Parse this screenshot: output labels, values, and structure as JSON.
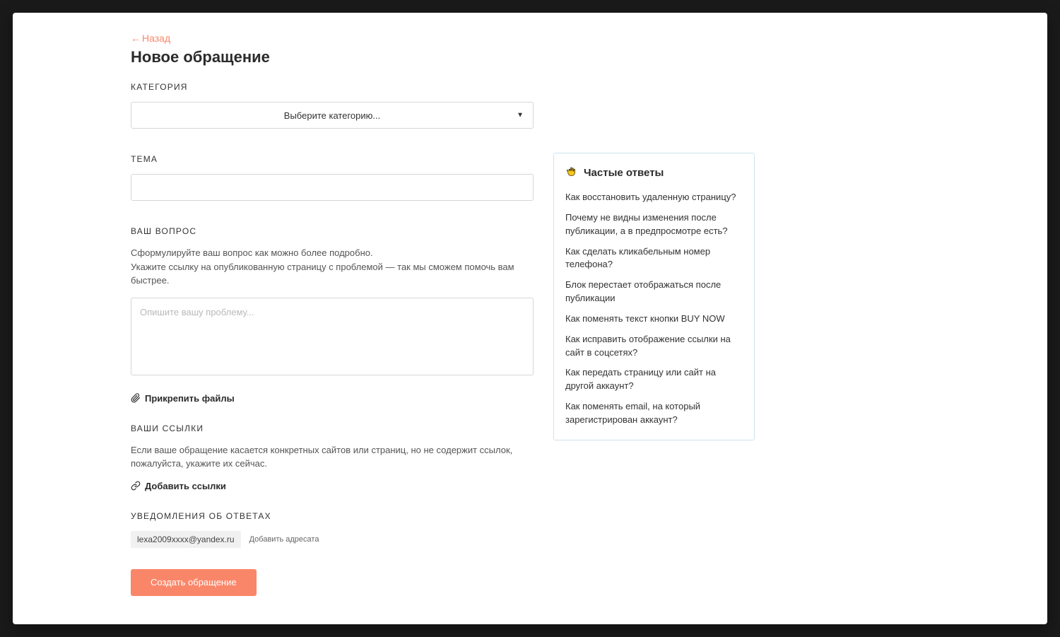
{
  "back": {
    "label": "Назад"
  },
  "page": {
    "title": "Новое обращение"
  },
  "category": {
    "label": "КАТЕГОРИЯ",
    "placeholder": "Выберите категорию..."
  },
  "subject": {
    "label": "ТЕМА"
  },
  "question": {
    "label": "ВАШ ВОПРОС",
    "help_line1": "Сформулируйте ваш вопрос как можно более подробно.",
    "help_line2": "Укажите ссылку на опубликованную страницу с проблемой — так мы сможем помочь вам быстрее.",
    "placeholder": "Опишите вашу проблему..."
  },
  "attach": {
    "label": "Прикрепить файлы"
  },
  "links": {
    "label": "ВАШИ ССЫЛКИ",
    "help": "Если ваше обращение касается конкретных сайтов или страниц, но не содержит ссылок, пожалуйста, укажите их сейчас.",
    "action": "Добавить ссылки"
  },
  "notify": {
    "label": "УВЕДОМЛЕНИЯ ОБ ОТВЕТАХ",
    "email": "lexa2009xxxx@yandex.ru",
    "add": "Добавить адресата"
  },
  "submit": {
    "label": "Создать обращение"
  },
  "faq": {
    "title": "Частые ответы",
    "items": [
      "Как восстановить удаленную страницу?",
      "Почему не видны изменения после публикации, а в предпросмотре есть?",
      "Как сделать кликабельным номер телефона?",
      "Блок перестает отображаться после публикации",
      "Как поменять текст кнопки BUY NOW",
      "Как исправить отображение ссылки на сайт в соцсетях?",
      "Как передать страницу или сайт на другой аккаунт?",
      "Как поменять email, на который зарегистрирован аккаунт?"
    ]
  }
}
